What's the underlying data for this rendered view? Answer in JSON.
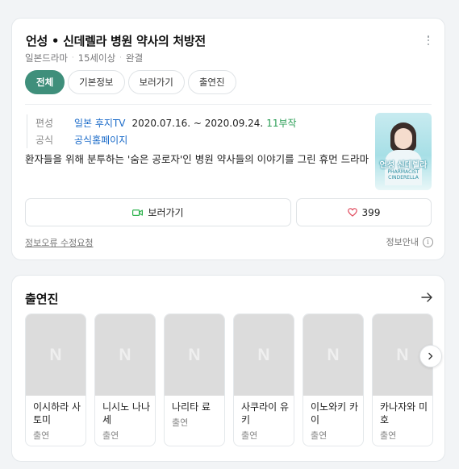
{
  "info": {
    "title": "언성 • 신데렐라 병원 약사의 처방전",
    "meta": [
      "일본드라마",
      "15세이상",
      "완결"
    ],
    "tabs": [
      {
        "label": "전체",
        "active": true
      },
      {
        "label": "기본정보",
        "active": false
      },
      {
        "label": "보러가기",
        "active": false
      },
      {
        "label": "출연진",
        "active": false
      }
    ],
    "rows": {
      "broadcast_label": "편성",
      "channel": "일본 후지TV",
      "period": "2020.07.16. ~ 2020.09.24.",
      "episodes": "11부작",
      "official_label": "공식",
      "homepage": "공식홈페이지"
    },
    "description": "환자들을 위해 분투하는 '숨은 공로자'인 병원 약사들의 이야기를 그린 휴먼 드라마",
    "poster": {
      "title": "언성 신데렐라",
      "subtitle": "PHARMACIST CINDERELLA"
    },
    "watch_label": "보러가기",
    "like_count": "399",
    "report_label": "정보오류 수정요청",
    "guide_label": "정보안내"
  },
  "cast": {
    "title": "출연진",
    "placeholder_letter": "N",
    "items": [
      {
        "name": "이시하라 사토미",
        "role": "출연"
      },
      {
        "name": "니시노 나나세",
        "role": "출연"
      },
      {
        "name": "나리타 료",
        "role": "출연"
      },
      {
        "name": "사쿠라이 유키",
        "role": "출연"
      },
      {
        "name": "이노와키 카이",
        "role": "출연"
      },
      {
        "name": "카나자와 미호",
        "role": "출연"
      }
    ]
  },
  "colors": {
    "accent": "#3f8f7b",
    "link": "#1b6bc9",
    "green": "#2a9d55",
    "heart": "#e0475a",
    "cam": "#2ab14a"
  },
  "icons": [
    "more-vertical-icon",
    "video-camera-icon",
    "heart-icon",
    "info-icon",
    "arrow-right-icon",
    "chevron-right-icon"
  ]
}
